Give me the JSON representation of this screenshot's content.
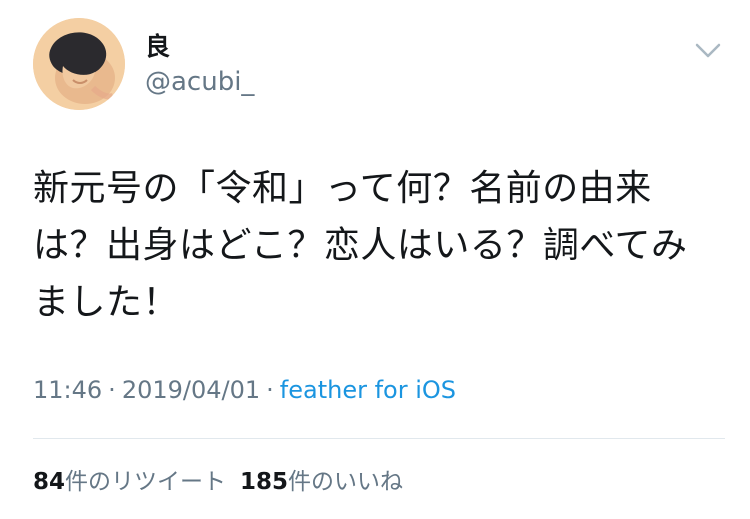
{
  "user": {
    "display_name": "良",
    "handle": "@acubi_"
  },
  "tweet": {
    "text": "新元号の「令和」って何？名前の由来は？出身はどこ？恋人はいる？調べてみました！",
    "time": "11:46",
    "separator": "·",
    "date": "2019/04/01",
    "source": "feather for iOS"
  },
  "stats": {
    "retweets_count": "84",
    "retweets_label": "件のリツイート",
    "likes_count": "185",
    "likes_label": "件のいいね"
  },
  "icons": {
    "menu": "chevron-down-icon"
  },
  "colors": {
    "text_primary": "#14171a",
    "text_secondary": "#657786",
    "link": "#1b95e0",
    "divider": "#e1e8ed",
    "avatar_bg": "#f4cfa3"
  }
}
